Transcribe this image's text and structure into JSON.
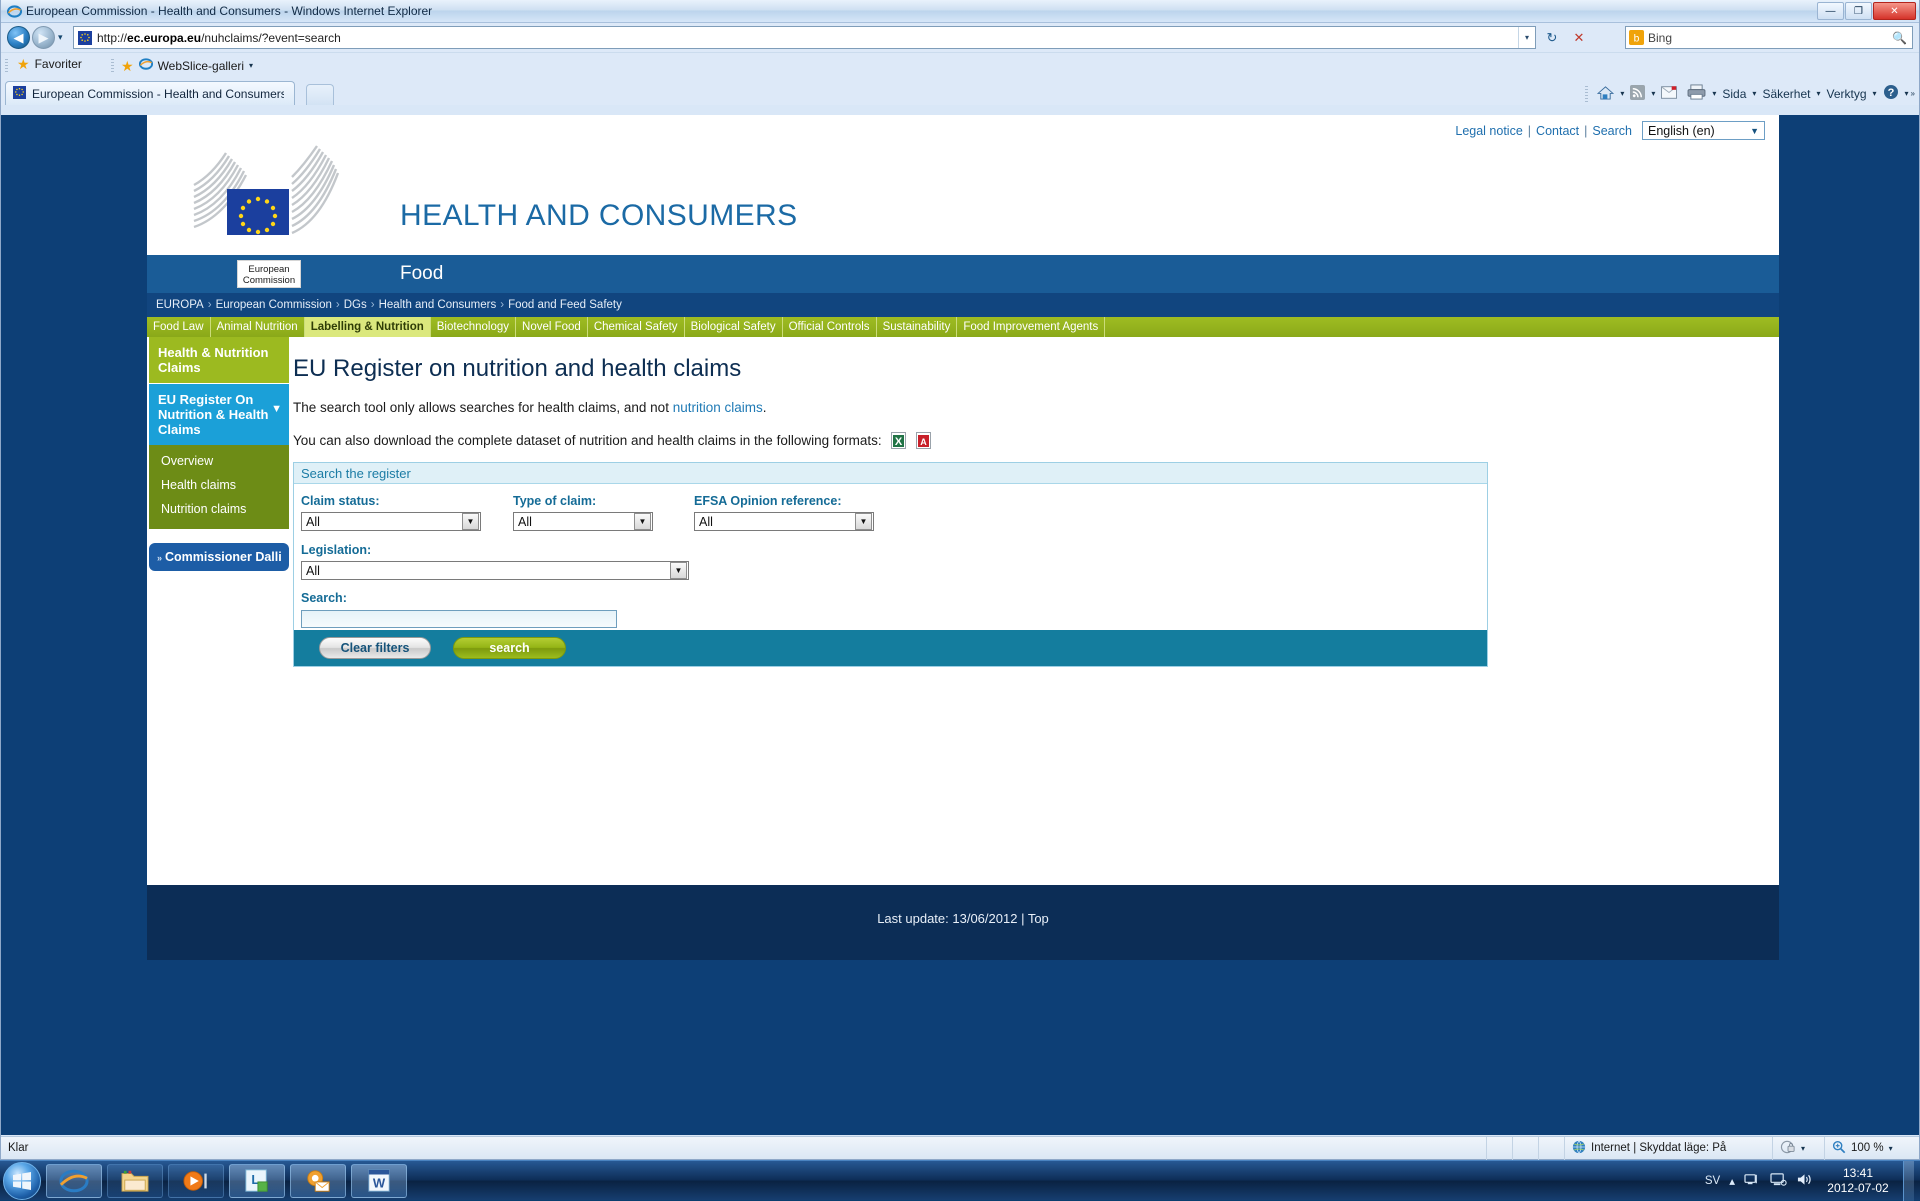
{
  "window": {
    "title": "European Commission - Health and Consumers - Windows Internet Explorer",
    "minimize_label": "—",
    "maximize_label": "❐",
    "close_label": "✕"
  },
  "browser": {
    "back_label": "◀",
    "forward_label": "▶",
    "history_label": "▾",
    "url_prefix": "http://",
    "url_domain": "ec.europa.eu",
    "url_path": "/nuhclaims/?event=search",
    "addr_dropdown": "▾",
    "refresh_label": "↻",
    "stop_label": "✕",
    "search_placeholder": "Bing",
    "search_go": "🔍",
    "favorites_label": "Favoriter",
    "webslice_label": "WebSlice-galleri",
    "webslice_caret": "▾",
    "tab_label": "European Commission - Health and Consumers",
    "command_items": [
      {
        "name": "home-icon",
        "glyph": "⌂",
        "caret": "▾"
      },
      {
        "name": "feeds-icon",
        "glyph": "◕",
        "caret": "▾"
      },
      {
        "name": "read-mail-icon",
        "glyph": "✉",
        "caret": ""
      },
      {
        "name": "print-icon",
        "glyph": "🖶",
        "caret": "▾"
      }
    ],
    "command_menus": [
      {
        "label": "Sida",
        "caret": "▾"
      },
      {
        "label": "Säkerhet",
        "caret": "▾"
      },
      {
        "label": "Verktyg",
        "caret": "▾"
      }
    ],
    "help_glyph": "?",
    "help_caret": "▾",
    "overflow_label": "»"
  },
  "statusbar": {
    "status_text": "Klar",
    "zone_text": "Internet | Skyddat läge: På",
    "zone_icon": "globe-icon",
    "privacy_icon": "privacy-icon",
    "privacy_caret": "▾",
    "zoom_icon": "zoom-icon",
    "zoom_level": "100 %",
    "zoom_caret": "▾"
  },
  "taskbar": {
    "start_label": "start-orb",
    "items": [
      {
        "name": "taskbar-internet-explorer",
        "glyph": "e"
      },
      {
        "name": "taskbar-windows-explorer",
        "glyph": "🗀"
      },
      {
        "name": "taskbar-media-player",
        "glyph": "▶"
      },
      {
        "name": "taskbar-lync",
        "glyph": "L"
      },
      {
        "name": "taskbar-outlook",
        "glyph": "O"
      },
      {
        "name": "taskbar-word",
        "glyph": "W"
      }
    ],
    "tray_language": "SV",
    "tray_expand": "▴",
    "tray_icons": [
      "network-icon",
      "display-icon",
      "volume-icon"
    ],
    "clock_time": "13:41",
    "clock_date": "2012-07-02"
  },
  "page": {
    "utility_links": [
      {
        "label": "Legal notice"
      },
      {
        "label": "Contact"
      },
      {
        "label": "Search"
      }
    ],
    "utility_sep": "|",
    "language_selected": "English (en)",
    "language_caret": "▼",
    "logo_caption_line1": "European",
    "logo_caption_line2": "Commission",
    "site_title": "HEALTH AND CONSUMERS",
    "site_subtitle": "Food",
    "breadcrumb": [
      "EUROPA",
      "European Commission",
      "DGs",
      "Health and Consumers",
      "Food and Feed Safety"
    ],
    "breadcrumb_arrow": "›",
    "topic_tabs": [
      {
        "label": "Food Law",
        "active": false
      },
      {
        "label": "Animal Nutrition",
        "active": false
      },
      {
        "label": "Labelling & Nutrition",
        "active": true
      },
      {
        "label": "Biotechnology",
        "active": false
      },
      {
        "label": "Novel Food",
        "active": false
      },
      {
        "label": "Chemical Safety",
        "active": false
      },
      {
        "label": "Biological Safety",
        "active": false
      },
      {
        "label": "Official Controls",
        "active": false
      },
      {
        "label": "Sustainability",
        "active": false
      },
      {
        "label": "Food Improvement Agents",
        "active": false
      }
    ],
    "sidebar": {
      "section_title": "Health & Nutrition Claims",
      "active_item": "EU Register On Nutrition & Health Claims",
      "active_caret": "▼",
      "sub_items": [
        {
          "label": "Overview"
        },
        {
          "label": "Health claims"
        },
        {
          "label": "Nutrition claims"
        }
      ],
      "commissioner_bullets": "»",
      "commissioner_label": "Commissioner Dalli"
    },
    "heading": "EU Register on nutrition and health claims",
    "intro_line1_pre": "The search tool only allows searches for health claims, and not ",
    "intro_line1_link": "nutrition claims",
    "intro_line1_post": ".",
    "intro_line2": "You can also download the complete dataset of nutrition and health claims in the following formats:",
    "download_excel_icon": "excel-icon",
    "download_pdf_icon": "pdf-icon",
    "search_panel": {
      "title": "Search the register",
      "fields": [
        {
          "label": "Claim status:",
          "value": "All",
          "caret": "▼"
        },
        {
          "label": "Type of claim:",
          "value": "All",
          "caret": "▼"
        },
        {
          "label": "EFSA Opinion reference:",
          "value": "All",
          "caret": "▼"
        },
        {
          "label": "Legislation:",
          "value": "All",
          "caret": "▼"
        }
      ],
      "search_label": "Search:",
      "search_value": "",
      "clear_button": "Clear filters",
      "search_button": "search"
    },
    "footer_prefix": "Last update: ",
    "footer_date": "13/06/2012",
    "footer_sep": " | ",
    "footer_top": "Top"
  },
  "colors": {
    "eu_blue": "#1a5c97",
    "breadcrumb_blue": "#11457f",
    "tab_green": "#9fbc22",
    "tab_active": "#dbe87d",
    "sidebar_blue": "#1ba0d8",
    "panel_teal": "#147d9e",
    "link_blue": "#1f7ab5"
  }
}
